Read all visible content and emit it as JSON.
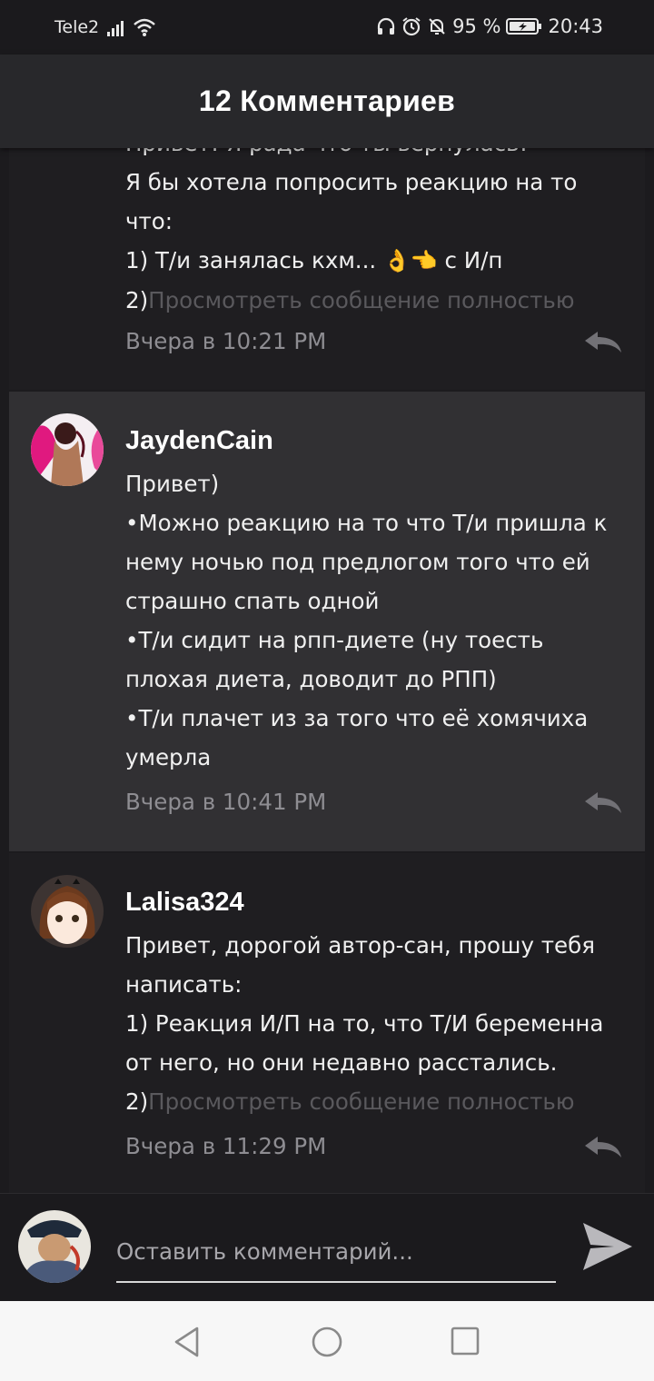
{
  "status_bar": {
    "carrier": "Tele2",
    "battery": "95 %",
    "time": "20:43"
  },
  "header": {
    "title": "12 Комментариев"
  },
  "comments": [
    {
      "lines": [
        "Привет! Я рада что ты вернулась! ^^",
        "Я бы хотела попросить реакцию на то",
        "что:",
        "1) Т/и занялась кхм... "
      ],
      "line4_emojis": "👌👈",
      "line4_suffix": " с И/п",
      "truncated_prefix": "2)",
      "show_more": "Просмотреть сообщение полностью",
      "time": "Вчера в 10:21 PM"
    },
    {
      "username": "JaydenCain",
      "lines": [
        "Привет)",
        "•Можно реакцию на то что Т/и пришла к",
        "нему ночью под предлогом того что ей",
        "страшно спать одной",
        "•Т/и сидит на рпп-диете (ну тоесть",
        "плохая диета, доводит до РПП)",
        "•Т/и плачет из за того что её хомячиха",
        "умерла"
      ],
      "time": "Вчера в 10:41 PM"
    },
    {
      "username": "Lalisa324",
      "lines": [
        "Привет, дорогой автор-сан, прошу тебя",
        "написать:",
        "1) Реакция И/П на то, что Т/И беременна",
        "от него, но они недавно расстались."
      ],
      "truncated_prefix": "2)",
      "show_more": "Просмотреть сообщение полностью",
      "time": "Вчера в 11:29 PM"
    }
  ],
  "input": {
    "placeholder": "Оставить комментарий..."
  },
  "colors": {
    "background": "#1c1b1e",
    "highlight": "#313033",
    "header": "#28282b",
    "muted_text": "#8e8d92"
  },
  "icons": [
    "signal-icon",
    "wifi-icon",
    "headphones-icon",
    "alarm-icon",
    "mute-icon",
    "battery-icon",
    "reply-icon",
    "send-icon",
    "back-icon",
    "home-icon",
    "recents-icon"
  ]
}
